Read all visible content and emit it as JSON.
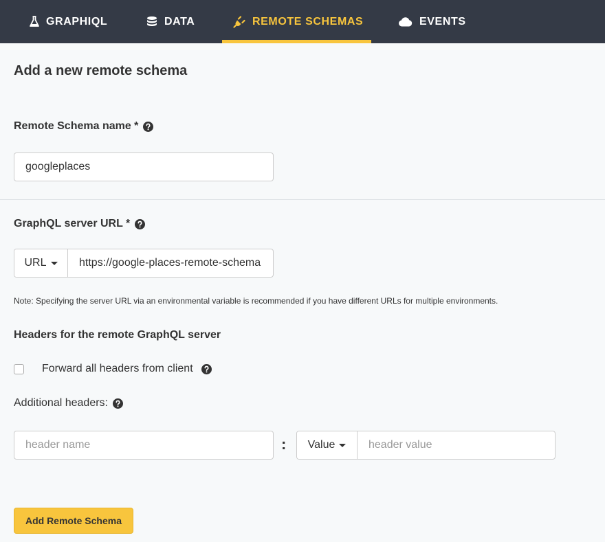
{
  "nav": {
    "tabs": [
      {
        "label": "GRAPHIQL",
        "icon": "flask-icon",
        "active": false
      },
      {
        "label": "DATA",
        "icon": "database-icon",
        "active": false
      },
      {
        "label": "REMOTE SCHEMAS",
        "icon": "plug-icon",
        "active": true
      },
      {
        "label": "EVENTS",
        "icon": "cloud-icon",
        "active": false
      }
    ],
    "active_color": "#f8c53d",
    "background": "#343a46"
  },
  "page": {
    "title": "Add a new remote schema"
  },
  "form": {
    "schema_name": {
      "label": "Remote Schema name *",
      "value": "googleplaces"
    },
    "server_url": {
      "label": "GraphQL server URL *",
      "type_option": "URL",
      "value": "https://google-places-remote-schema"
    },
    "note": "Note: Specifying the server URL via an environmental variable is recommended if you have different URLs for multiple environments.",
    "headers": {
      "title": "Headers for the remote GraphQL server",
      "forward_label": "Forward all headers from client",
      "forward_checked": false,
      "additional_label": "Additional headers:",
      "name_placeholder": "header name",
      "separator": ":",
      "value_type_option": "Value",
      "value_placeholder": "header value"
    },
    "submit_label": "Add Remote Schema"
  }
}
